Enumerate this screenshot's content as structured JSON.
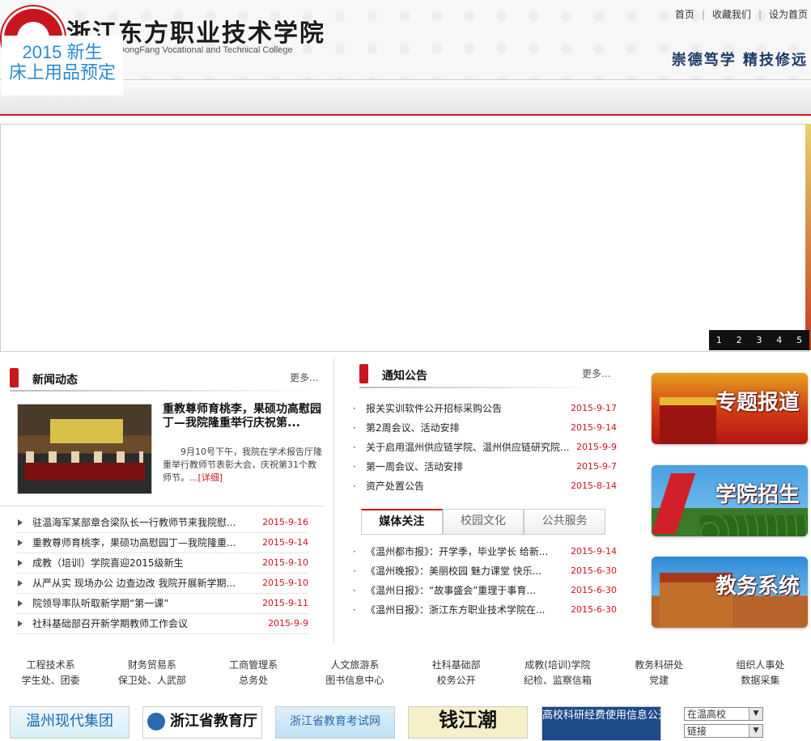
{
  "header": {
    "school_name": "浙江东方职业技术学院",
    "school_name_en": "DongFang Vocational and Technical College",
    "promo_line1": "2015   新生",
    "promo_line2": "床上用品预定",
    "top_links": [
      "首页",
      "收藏我们",
      "设为首页"
    ],
    "motto": "崇德笃学  精技修远"
  },
  "banner": {
    "pager": [
      "1",
      "2",
      "3",
      "4",
      "5"
    ]
  },
  "news": {
    "title": "新闻动态",
    "more": "更多...",
    "feature": {
      "title": "重教尊师育桃李，果硕功高慰园丁—我院隆重举行庆祝第...",
      "desc": "9月10号下午，我院在学术报告厅隆重举行教师节表彰大会，庆祝第31个教师节。...",
      "detail": "[详细]"
    },
    "items": [
      {
        "text": "驻温海军某部章合梁队长一行教师节来我院慰...",
        "date": "2015-9-16"
      },
      {
        "text": "重教尊师育桃李，果硕功高慰园丁—我院隆重...",
        "date": "2015-9-14"
      },
      {
        "text": "成教（培训）学院喜迎2015级新生",
        "date": "2015-9-10"
      },
      {
        "text": "从严从实 现场办公 边查边改 我院开展新学期...",
        "date": "2015-9-10"
      },
      {
        "text": "院领导率队听取新学期“第一课”",
        "date": "2015-9-11"
      },
      {
        "text": "社科基础部召开新学期教师工作会议",
        "date": "2015-9-9"
      }
    ]
  },
  "notice": {
    "title": "通知公告",
    "more": "更多...",
    "items": [
      {
        "text": "报关实训软件公开招标采购公告",
        "date": "2015-9-17"
      },
      {
        "text": "第2周会议、活动安排",
        "date": "2015-9-14"
      },
      {
        "text": "关于启用温州供应链学院、温州供应链研究院...",
        "date": "2015-9-9"
      },
      {
        "text": "第一周会议、活动安排",
        "date": "2015-9-7"
      },
      {
        "text": "资产处置公告",
        "date": "2015-8-14"
      }
    ]
  },
  "media": {
    "tabs": [
      "媒体关注",
      "校园文化",
      "公共服务"
    ],
    "items": [
      {
        "text": "《温州都市报》：开学季，毕业学长 给新...",
        "date": "2015-9-14"
      },
      {
        "text": "《温州晚报》：美丽校园 魅力课堂 快乐...",
        "date": "2015-6-30"
      },
      {
        "text": "《温州日报》：“故事盛会”重理于事育...",
        "date": "2015-6-30"
      },
      {
        "text": "《温州日报》：浙江东方职业技术学院在...",
        "date": "2015-6-30"
      }
    ]
  },
  "side_banners": [
    "专题报道",
    "学院招生",
    "教务系统"
  ],
  "departments": {
    "row1": [
      "工程技术系",
      "财务贸易系",
      "工商管理系",
      "人文旅游系",
      "社科基础部",
      "成教(培训)学院",
      "教务科研处",
      "组织人事处"
    ],
    "row2": [
      "学生处、团委",
      "保卫处、人武部",
      "总务处",
      "图书信息中心",
      "校务公开",
      "纪检、监察信箱",
      "党建",
      "数据采集"
    ]
  },
  "footer_logos": [
    "温州现代集团",
    "浙江省教育厅",
    "浙江省教育考试网",
    "钱江潮",
    "高校科研经费使用信息公开"
  ],
  "selects": {
    "region": "在温高校",
    "links": "链接"
  }
}
